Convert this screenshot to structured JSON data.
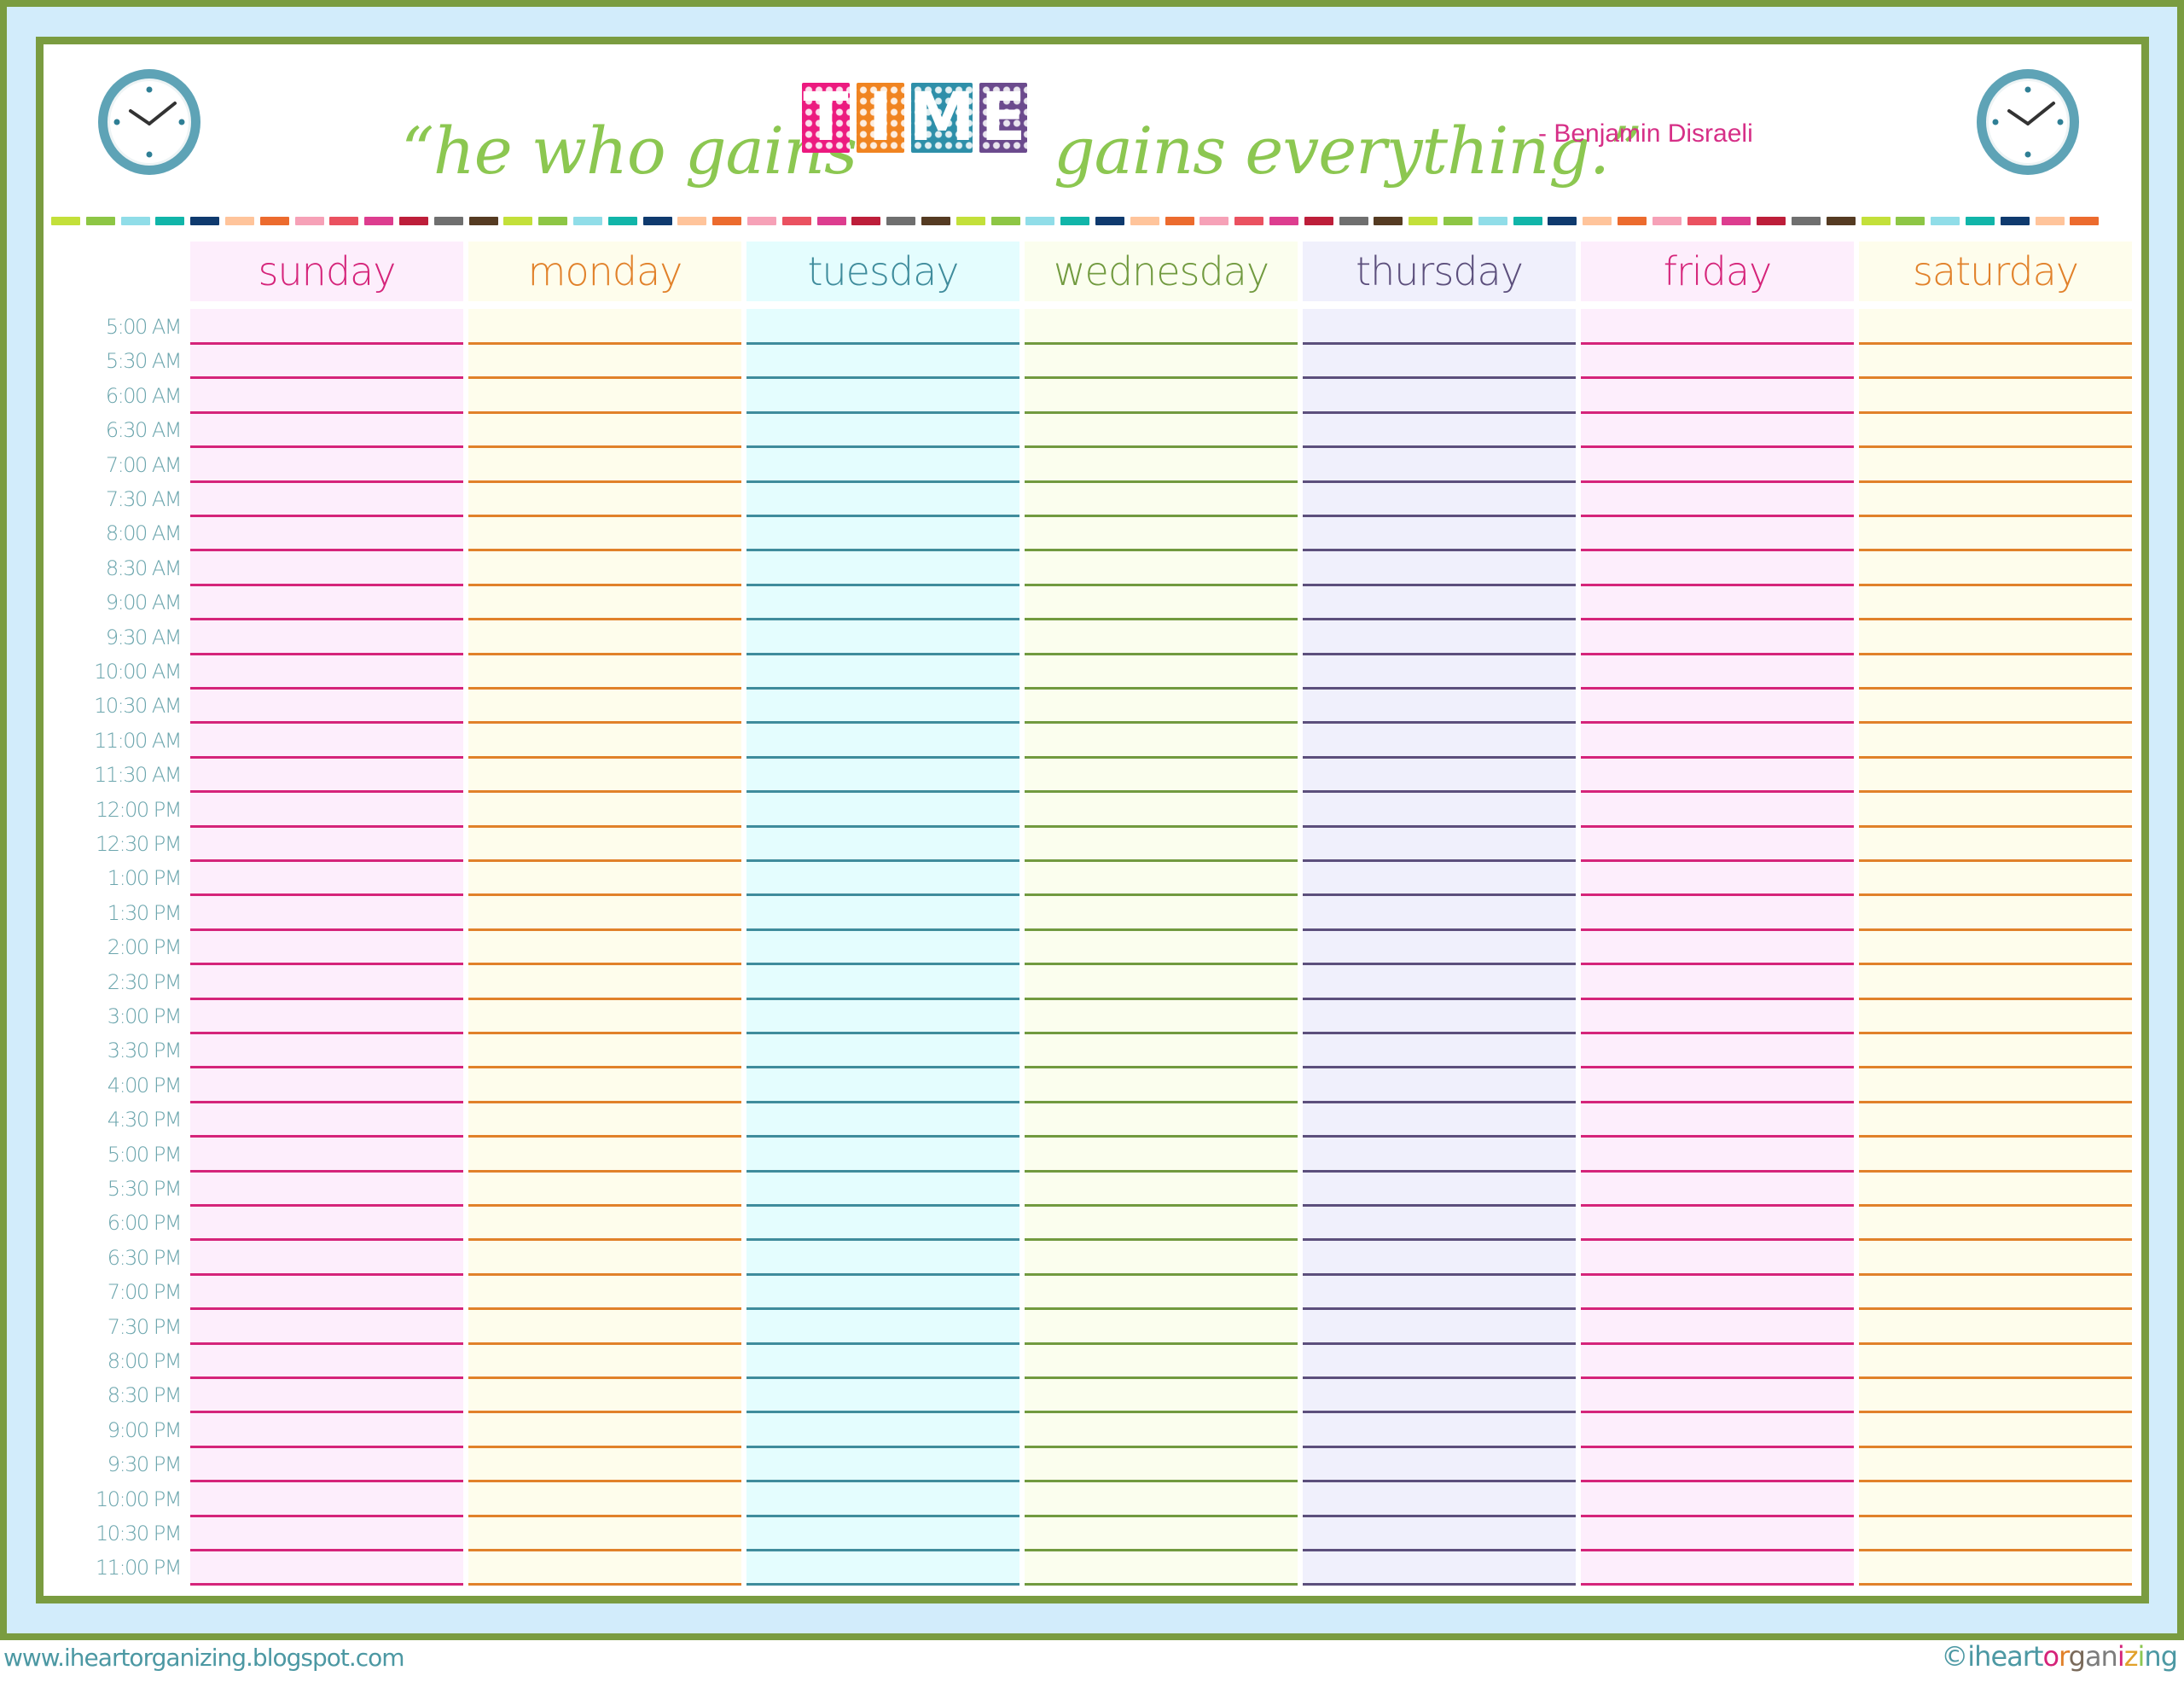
{
  "quote": {
    "open_quote": "“",
    "part1": "“he who gains",
    "highlight": "TIME",
    "highlight_letters": [
      {
        "char": "T",
        "color": "#ec1a7f"
      },
      {
        "char": "I",
        "color": "#f08421"
      },
      {
        "char": "M",
        "color": "#2e8fa9"
      },
      {
        "char": "E",
        "color": "#6b4a8d"
      }
    ],
    "part2": "gains everything.”",
    "attribution": "- Benjamin Disraeli",
    "script_color": "#8cc751",
    "attribution_color": "#d62f87"
  },
  "icons": {
    "left": "clock-icon",
    "right": "clock-icon"
  },
  "dash_colors": [
    "#c3e03a",
    "#8dc645",
    "#90dde8",
    "#11b5a9",
    "#0f3a6e",
    "#ffc49b",
    "#ec6b2e",
    "#f6a1b7",
    "#ea5160",
    "#dd3d8f",
    "#bd1e3a",
    "#6f6f6f",
    "#553b22"
  ],
  "days": [
    {
      "label": "sunday",
      "text_color": "#d5247a",
      "line_color": "#d5247a",
      "bg": "#fdeefc"
    },
    {
      "label": "monday",
      "text_color": "#e1812a",
      "line_color": "#e1812a",
      "bg": "#fefdec"
    },
    {
      "label": "tuesday",
      "text_color": "#3f8c9c",
      "line_color": "#3f8c9c",
      "bg": "#e4fdfe"
    },
    {
      "label": "wednesday",
      "text_color": "#719a3f",
      "line_color": "#719a3f",
      "bg": "#fbfeee"
    },
    {
      "label": "thursday",
      "text_color": "#5c4f7c",
      "line_color": "#5c4f7c",
      "bg": "#f0f0fc"
    },
    {
      "label": "friday",
      "text_color": "#d5247a",
      "line_color": "#d5247a",
      "bg": "#fdeefc"
    },
    {
      "label": "saturday",
      "text_color": "#e1812a",
      "line_color": "#e1812a",
      "bg": "#fefdec"
    }
  ],
  "time_slots": [
    "5:00 AM",
    "5:30 AM",
    "6:00 AM",
    "6:30 AM",
    "7:00 AM",
    "7:30 AM",
    "8:00 AM",
    "8:30 AM",
    "9:00 AM",
    "9:30 AM",
    "10:00 AM",
    "10:30 AM",
    "11:00 AM",
    "11:30 AM",
    "12:00 PM",
    "12:30 PM",
    "1:00 PM",
    "1:30 PM",
    "2:00 PM",
    "2:30 PM",
    "3:00 PM",
    "3:30 PM",
    "4:00 PM",
    "4:30 PM",
    "5:00 PM",
    "5:30 PM",
    "6:00 PM",
    "6:30 PM",
    "7:00 PM",
    "7:30 PM",
    "8:00 PM",
    "8:30 PM",
    "9:00 PM",
    "9:30 PM",
    "10:00 PM",
    "10:30 PM",
    "11:00 PM"
  ],
  "footer": {
    "website": "www.iheartorganizing.blogspot.com",
    "brand_letters": [
      {
        "char": "©iheart",
        "color": "#4c98a3"
      },
      {
        "char": "o",
        "color": "#d5247a"
      },
      {
        "char": "r",
        "color": "#e1812a"
      },
      {
        "char": "g",
        "color": "#7a6a5a"
      },
      {
        "char": "a",
        "color": "#7d7d7d"
      },
      {
        "char": "n",
        "color": "#7d7d7d"
      },
      {
        "char": "i",
        "color": "#d5247a"
      },
      {
        "char": "z",
        "color": "#e1a12a"
      },
      {
        "char": "i",
        "color": "#8cc751"
      },
      {
        "char": "ng",
        "color": "#4c98a3"
      }
    ]
  }
}
